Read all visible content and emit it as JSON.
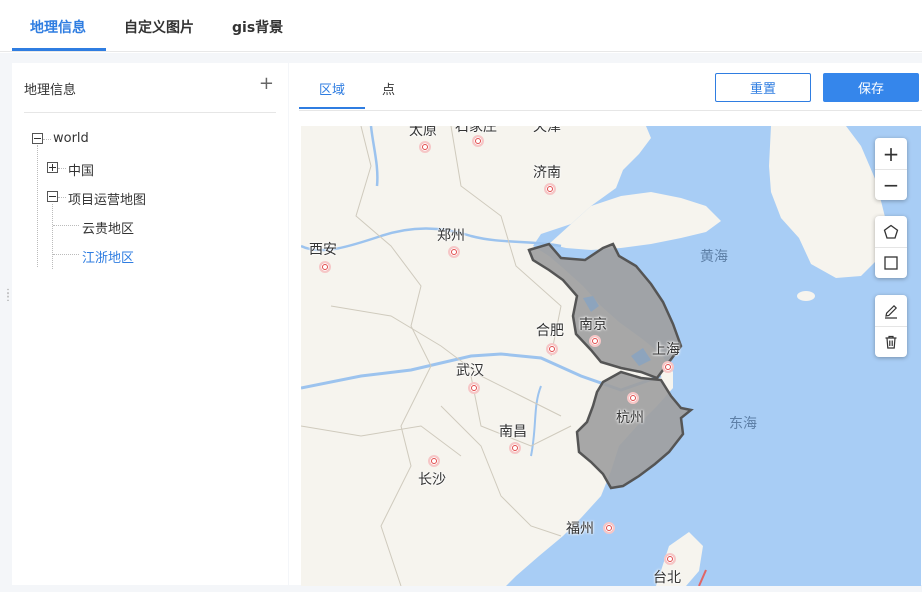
{
  "top_tabs": [
    {
      "label": "地理信息",
      "active": true
    },
    {
      "label": "自定义图片",
      "active": false
    },
    {
      "label": "gis背景",
      "active": false
    }
  ],
  "left_panel": {
    "title": "地理信息",
    "add_icon": "+",
    "tree": {
      "root": "world",
      "china": "中国",
      "project": "项目运营地图",
      "guizhou": "云贵地区",
      "jiangzhe": "江浙地区"
    }
  },
  "right_panel": {
    "sub_tabs": [
      {
        "label": "区域",
        "active": true
      },
      {
        "label": "点",
        "active": false
      }
    ],
    "reset_label": "重置",
    "save_label": "保存"
  },
  "map": {
    "cities": {
      "taiyuan": "太原",
      "shijiazhuang": "石家庄",
      "tianjin": "天津",
      "jinan": "济南",
      "zhengzhou": "郑州",
      "xian": "西安",
      "hefei": "合肥",
      "nanjing": "南京",
      "shanghai": "上海",
      "wuhan": "武汉",
      "hangzhou": "杭州",
      "nanchang": "南昌",
      "changsha": "长沙",
      "fuzhou": "福州",
      "taibei": "台北"
    },
    "seas": {
      "huanghai": "黄海",
      "donghai": "东海"
    },
    "colors": {
      "sea": "#a8cdf5",
      "land": "#f6f4ee",
      "polygon_fill": "#9e9e9e",
      "accent": "#2f7de1"
    },
    "controls": [
      "zoom-in-icon",
      "zoom-out-icon",
      "polygon-icon",
      "rectangle-icon",
      "edit-icon",
      "trash-icon"
    ]
  }
}
